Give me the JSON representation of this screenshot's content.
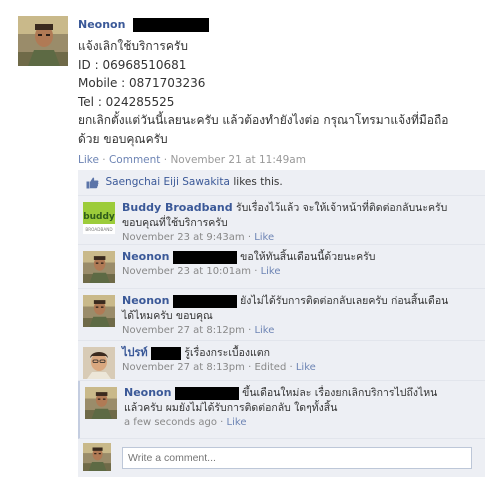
{
  "post": {
    "author": "Neonon",
    "message_lines": [
      "แจ้งเลิกใช้บริการครับ",
      "ID : 06968510681",
      "Mobile : 0871703236",
      "Tel : 024285525",
      "ยกเลิกตั้งแต่วันนี้เลยนะครับ แล้วต้องทำยังไงต่อ กรุณาโทรมาแจ้งที่มือถือ",
      "ด้วย ขอบคุณครับ"
    ],
    "like_label": "Like",
    "comment_label": "Comment",
    "timestamp": "November 21 at 11:49am"
  },
  "likes": {
    "names": "Saengchai Eiji Sawakita",
    "suffix": "likes this."
  },
  "comments": [
    {
      "author": "Buddy Broadband",
      "text_lines": [
        "รับเรื่องไว้แล้ว จะให้เจ้าหน้าที่ติดต่อกลับนะครับ",
        "ขอบคุณที่ใช้บริการครับ"
      ],
      "timestamp": "November 23 at 9:43am",
      "edited": "",
      "like_label": "Like",
      "logo_text": "buddy",
      "logo_sub": "BROADBAND"
    },
    {
      "author": "Neonon",
      "text_lines": [
        "ขอให้ทันสิ้นเดือนนี้ด้วยนะครับ"
      ],
      "timestamp": "November 23 at 10:01am",
      "edited": "",
      "like_label": "Like"
    },
    {
      "author": "Neonon",
      "text_lines": [
        "ยังไม่ได้รับการติดต่อกลับเลยครับ ก่อนสิ้นเดือน",
        "ได้ไหมครับ ขอบคุณ"
      ],
      "timestamp": "November 27 at 8:12pm",
      "edited": "",
      "like_label": "Like"
    },
    {
      "author": "ไปรท์",
      "text_lines": [
        "รู้เรื่องกระเบื้องแตก"
      ],
      "timestamp": "November 27 at 8:13pm",
      "edited": "Edited",
      "like_label": "Like"
    },
    {
      "author": "Neonon",
      "text_lines": [
        "ขึ้นเดือนใหม่ละ เรื่องยกเลิกบริการไปถึงไหน",
        "แล้วครับ ผมยังไม่ได้รับการติดต่อกลับ ใดๆทั้งสิ้น"
      ],
      "timestamp": "a few seconds ago",
      "edited": "",
      "like_label": "Like"
    }
  ],
  "composer": {
    "placeholder": "Write a comment..."
  },
  "colors": {
    "link_blue": "#3b5998",
    "feedback_bg": "#edeff4",
    "redaction": "#000000"
  }
}
